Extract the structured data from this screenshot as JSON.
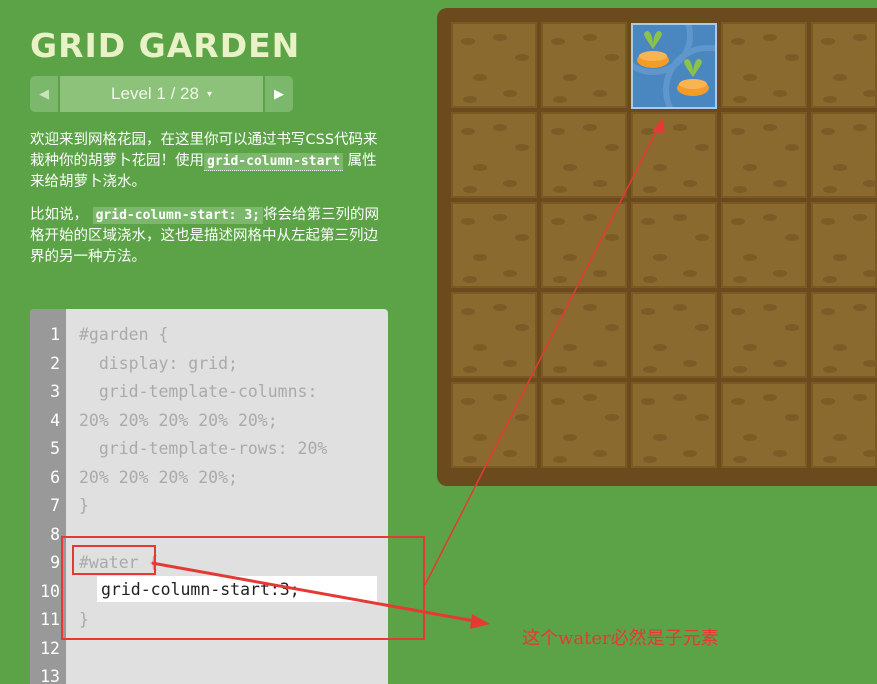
{
  "title": "GRID GARDEN",
  "level": {
    "prev_icon": "◀",
    "label": "Level 1 / 28",
    "caret": "▾",
    "next_icon": "▶"
  },
  "intro": {
    "p1_a": "欢迎来到网格花园，在这里你可以通过书写CSS代码来栽种你的胡萝卜花园！使用",
    "p1_code": "grid-column-start",
    "p1_b": "属性来给胡萝卜浇水。",
    "p2_a": "比如说，",
    "p2_code": "grid-column-start: 3;",
    "p2_b": "将会给第三列的网格开始的区域浇水，这也是描述网格中从左起第三列边界的另一种方法。"
  },
  "editor": {
    "line_numbers": [
      "1",
      "2",
      "3",
      "4",
      "5",
      "6",
      "7",
      "8",
      "9",
      "10",
      "11",
      "12",
      "13"
    ],
    "lines": [
      "#garden {",
      "  display: grid;",
      "  grid-template-columns:",
      "20% 20% 20% 20% 20%;",
      "  grid-template-rows: 20%",
      "20% 20% 20% 20%;",
      "}",
      "",
      "#water {",
      "",
      "}",
      "",
      ""
    ],
    "input_value": "grid-column-start:3;"
  },
  "annotation": {
    "text": "这个water必然是子元素",
    "color": "#e53935"
  },
  "colors": {
    "background": "#5ba346",
    "board": "#6b4b1e",
    "soil": "#8a6a2e",
    "water": "#4a86c0"
  },
  "icons": {
    "carrot": "carrot-icon"
  }
}
